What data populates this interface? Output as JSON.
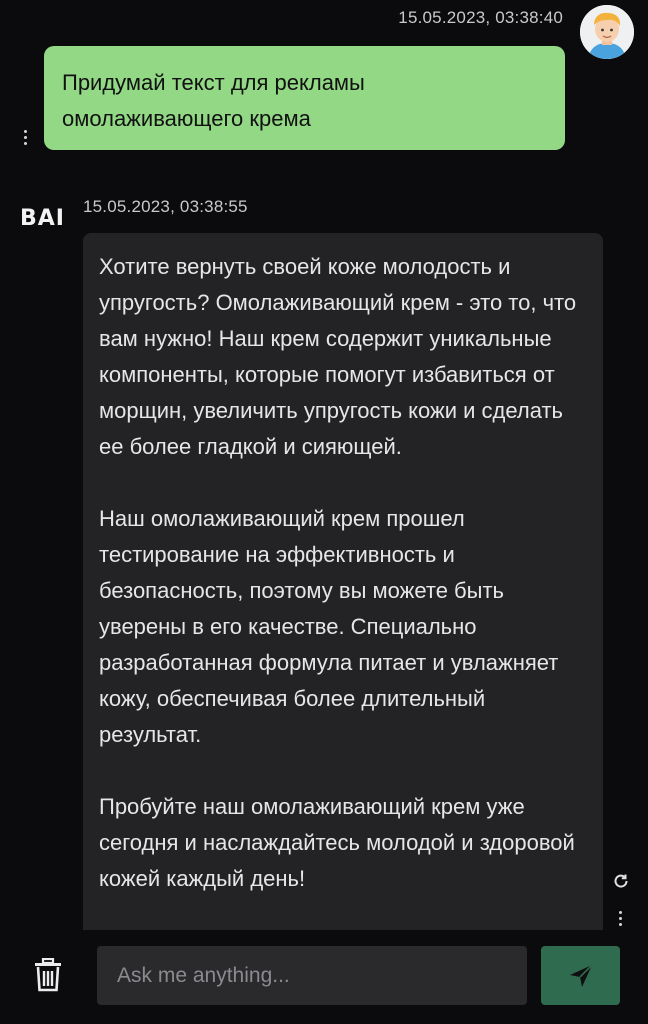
{
  "user_message": {
    "timestamp": "15.05.2023, 03:38:40",
    "text": "Придумай текст для рекламы омолаживающего крема",
    "avatar_icon": "user-avatar-icon",
    "bubble_color": "#93d985"
  },
  "bot_message": {
    "logo": "BAI",
    "timestamp": "15.05.2023, 03:38:55",
    "paragraphs": [
      "Хотите вернуть своей коже молодость и упругость? Омолаживающий крем - это то, что вам нужно! Наш крем содержит уникальные компоненты, которые помогут избавиться от морщин, увеличить упругость кожи и сделать ее более гладкой и сияющей.",
      "Наш омолаживающий крем прошел тестирование на эффективность и безопасность, поэтому вы можете быть уверены в его качестве. Специально разработанная формула питает и увлажняет кожу, обеспечивая более длительный результат.",
      "Пробуйте наш омолаживающий крем уже сегодня и наслаждайтесь молодой и здоровой кожей каждый день!"
    ],
    "bubble_color": "#232325"
  },
  "composer": {
    "placeholder": "Ask me anything...",
    "value": "",
    "send_icon": "send-icon",
    "delete_icon": "trash-icon",
    "send_color": "#2f6b4e"
  }
}
